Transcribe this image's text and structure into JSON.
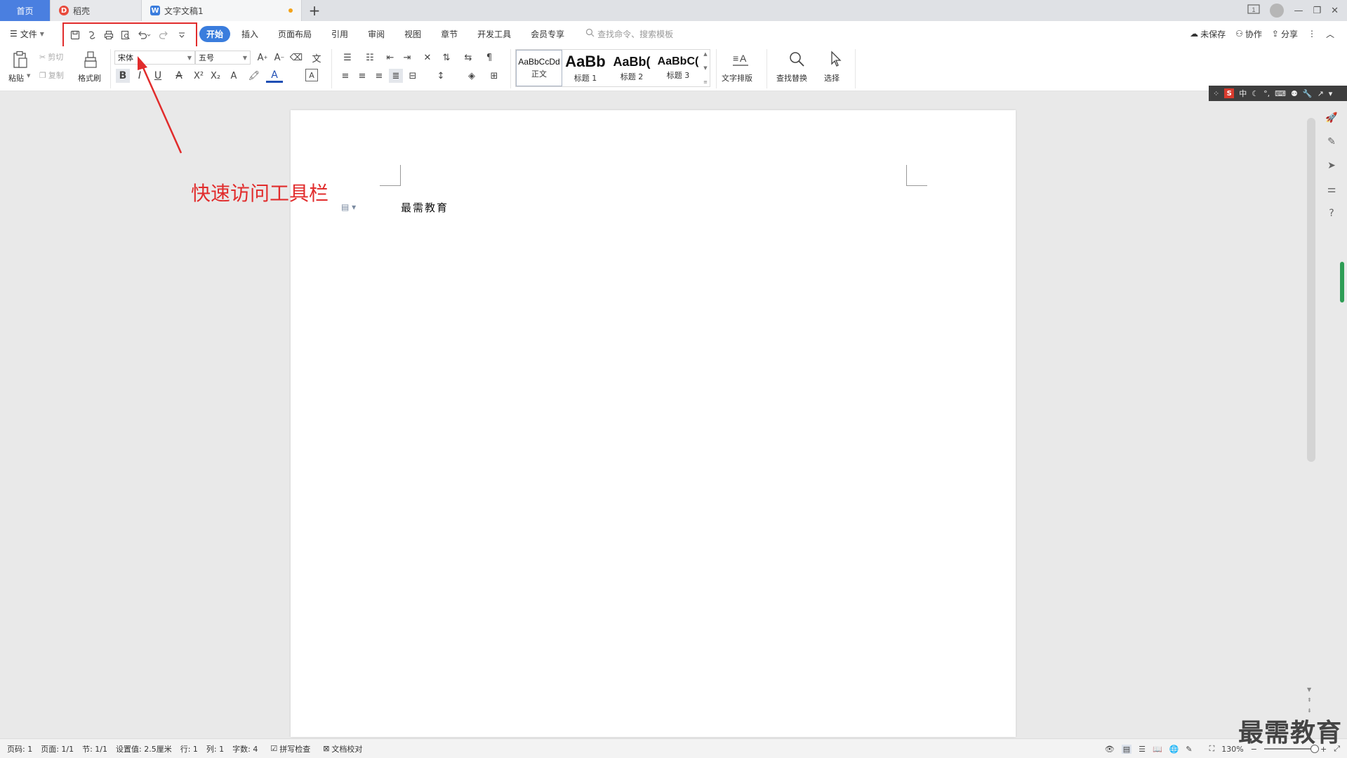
{
  "tabs": {
    "home": "首页",
    "docer": "稻壳",
    "doc": "文字文稿1",
    "add": "+"
  },
  "menu": {
    "file": "文件",
    "tabs": [
      "开始",
      "插入",
      "页面布局",
      "引用",
      "审阅",
      "视图",
      "章节",
      "开发工具",
      "会员专享"
    ],
    "search_placeholder": "查找命令、搜索模板",
    "unsaved": "未保存",
    "collab": "协作",
    "share": "分享"
  },
  "ribbon": {
    "paste": "粘贴",
    "cut": "剪切",
    "copy": "复制",
    "format_painter": "格式刷",
    "font_name": "宋体",
    "font_size": "五号",
    "styles": [
      {
        "preview": "AaBbCcDd",
        "name": "正文"
      },
      {
        "preview": "AaBb",
        "name": "标题 1"
      },
      {
        "preview": "AaBb(",
        "name": "标题 2"
      },
      {
        "preview": "AaBbC(",
        "name": "标题 3"
      }
    ],
    "text_layout": "文字排版",
    "find_replace": "查找替换",
    "select": "选择"
  },
  "document": {
    "text": "最需教育"
  },
  "annotation": {
    "label": "快速访问工具栏",
    "color": "#e12c2c"
  },
  "ime": {
    "logo": "S",
    "mode": "中"
  },
  "status": {
    "page_num": "页码: 1",
    "pages": "页面: 1/1",
    "section": "节: 1/1",
    "setting": "设置值: 2.5厘米",
    "row": "行: 1",
    "col": "列: 1",
    "word_count": "字数: 4",
    "spell_check": "拼写检查",
    "proof": "文档校对",
    "zoom": "130%"
  },
  "watermark": "最需教育",
  "colors": {
    "accent": "#3a7ddd",
    "home_tab": "#4a7fe0",
    "annotation": "#e12c2c"
  }
}
